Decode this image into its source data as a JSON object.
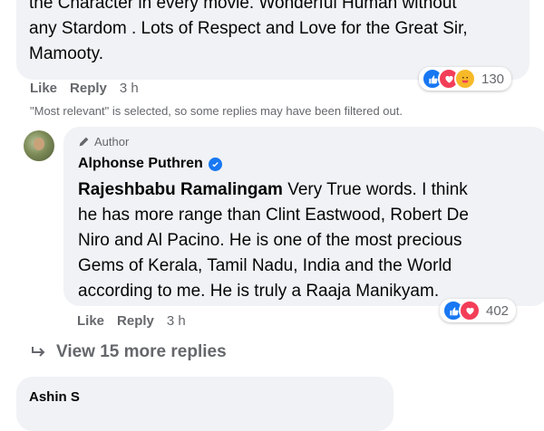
{
  "comment_top": {
    "text_line1": "the Character in every movie. Wonderful Human without",
    "text_line2": "any Stardom . Lots of Respect and Love for the Great Sir,",
    "text_line3": "Mamooty.",
    "reaction_count": "130",
    "reactions": [
      "like-icon",
      "love-icon",
      "care-icon"
    ],
    "like_label": "Like",
    "reply_label": "Reply",
    "time": "3 h"
  },
  "filter_note": "\"Most relevant\" is selected, so some replies may have been filtered out.",
  "reply": {
    "badge": "Author",
    "author_name": "Alphonse Puthren",
    "mention": "Rajeshbabu Ramalingam",
    "text_line1": " Very True words. I think",
    "text_line2": "he has more range than Clint Eastwood, Robert De",
    "text_line3": "Niro and Al Pacino. He is one of the most precious",
    "text_line4": "Gems of Kerala, Tamil Nadu, India and the World",
    "text_line5": "according to me. He is truly a Raaja Manikyam.",
    "reaction_count": "402",
    "reactions": [
      "like-icon",
      "love-icon"
    ],
    "like_label": "Like",
    "reply_label": "Reply",
    "time": "3 h"
  },
  "view_more": "View 15 more replies",
  "next_comment": {
    "author_name": "Ashin S"
  },
  "colors": {
    "bubble_bg": "#f0f2f5",
    "secondary_text": "#65676b",
    "like_blue": "#1877f2",
    "love_red": "#f33e58",
    "care_yellow": "#f7b928"
  }
}
